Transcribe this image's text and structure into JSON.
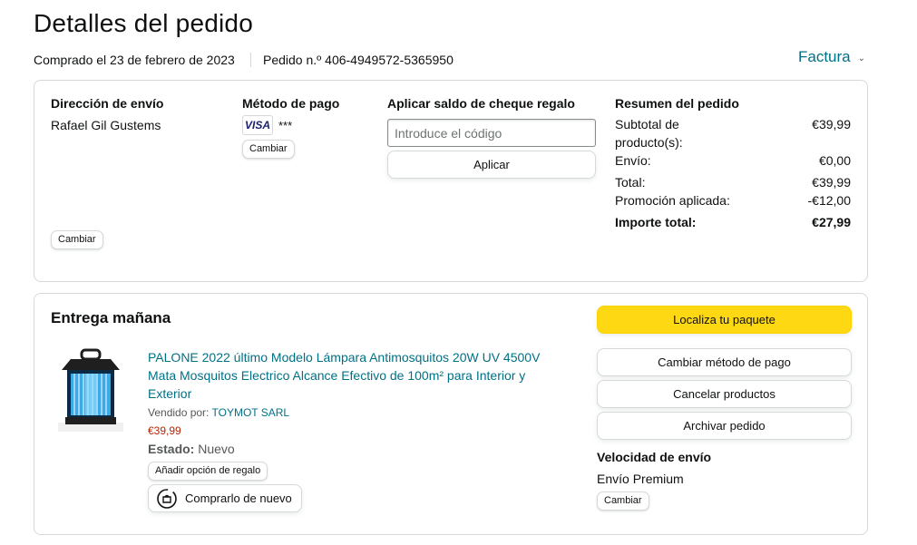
{
  "header": {
    "title": "Detalles del pedido",
    "purchase_date": "Comprado el 23 de febrero de 2023",
    "order_number": "Pedido n.º 406-4949572-5365950",
    "invoice": "Factura"
  },
  "shipping": {
    "heading": "Dirección de envío",
    "name": "Rafael Gil Gustems",
    "change": "Cambiar"
  },
  "payment": {
    "heading": "Método de pago",
    "card_brand": "VISA",
    "card_digits": "***",
    "change": "Cambiar"
  },
  "gift": {
    "heading": "Aplicar saldo de cheque regalo",
    "placeholder": "Introduce el código",
    "apply": "Aplicar"
  },
  "summary": {
    "heading": "Resumen del pedido",
    "subtotal_label": "Subtotal de producto(s):",
    "subtotal": "€39,99",
    "shipping_label": "Envío:",
    "shipping": "€0,00",
    "total_label": "Total:",
    "total": "€39,99",
    "promo_label": "Promoción aplicada:",
    "promo": "-€12,00",
    "grand_label": "Importe total:",
    "grand": "€27,99"
  },
  "delivery": {
    "heading": "Entrega mañana",
    "product_title": "PALONE 2022 último Modelo Lámpara Antimosquitos 20W UV 4500V Mata Mosquitos Electrico Alcance Efectivo de 100m² para Interior y Exterior",
    "sold_by_label": "Vendido por:",
    "seller": "TOYMOT SARL",
    "price": "€39,99",
    "condition_label": "Estado:",
    "condition": "Nuevo",
    "gift_option": "Añadir opción de regalo",
    "buy_again": "Comprarlo de nuevo"
  },
  "actions": {
    "track": "Localiza tu paquete",
    "change_payment": "Cambiar método de pago",
    "cancel": "Cancelar productos",
    "archive": "Archivar pedido"
  },
  "shipping_speed": {
    "heading": "Velocidad de envío",
    "value": "Envío Premium",
    "change": "Cambiar"
  },
  "colors": {
    "accent_link": "#007185",
    "primary_button": "#ffd814",
    "price": "#b12704"
  }
}
